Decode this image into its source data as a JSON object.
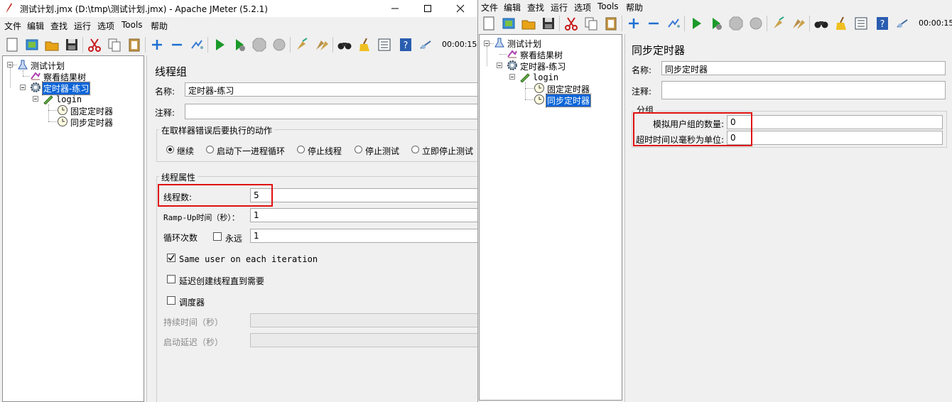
{
  "window1": {
    "title": "测试计划.jmx (D:\\tmp\\测试计划.jmx) - Apache JMeter (5.2.1)",
    "menu": [
      "文件",
      "编辑",
      "查找",
      "运行",
      "选项",
      "Tools",
      "帮助"
    ],
    "timer": "00:00:15",
    "tree": {
      "root": "测试计划",
      "listener": "察看结果树",
      "thread_group": "定时器-练习",
      "sampler": "login",
      "timer_fixed": "固定定时器",
      "timer_sync": "同步定时器"
    },
    "panel": {
      "title": "线程组",
      "name_label": "名称:",
      "name_value": "定时器-练习",
      "comment_label": "注释:",
      "comment_value": "",
      "error_group_title": "在取样器错误后要执行的动作",
      "error_options": [
        "继续",
        "启动下一进程循环",
        "停止线程",
        "停止测试",
        "立即停止测试"
      ],
      "props_title": "线程属性",
      "threads_label": "线程数:",
      "threads_value": "5",
      "rampup_label": "Ramp-Up时间（秒）：",
      "rampup_value": "1",
      "loop_label": "循环次数",
      "forever_label": "永远",
      "loop_value": "1",
      "same_user_label": "Same user on each iteration",
      "delay_label": "延迟创建线程直到需要",
      "scheduler_label": "调度器",
      "duration_label": "持续时间（秒）",
      "duration_value": "",
      "startup_delay_label": "启动延迟（秒）",
      "startup_delay_value": ""
    }
  },
  "window2": {
    "menu": [
      "文件",
      "编辑",
      "查找",
      "运行",
      "选项",
      "Tools",
      "帮助"
    ],
    "timer": "00:00:15",
    "tree": {
      "root": "测试计划",
      "listener": "察看结果树",
      "thread_group": "定时器-练习",
      "sampler": "login",
      "timer_fixed": "固定定时器",
      "timer_sync": "同步定时器"
    },
    "panel": {
      "title": "同步定时器",
      "name_label": "名称:",
      "name_value": "同步定时器",
      "comment_label": "注释:",
      "comment_value": "",
      "group_title": "分组",
      "users_label": "模拟用户组的数量:",
      "users_value": "0",
      "timeout_label": "超时时间以毫秒为单位:",
      "timeout_value": "0"
    }
  },
  "colors": {
    "selection": "#0a64d8",
    "highlight_box": "#e01010",
    "run_green": "#1a9a2a"
  }
}
